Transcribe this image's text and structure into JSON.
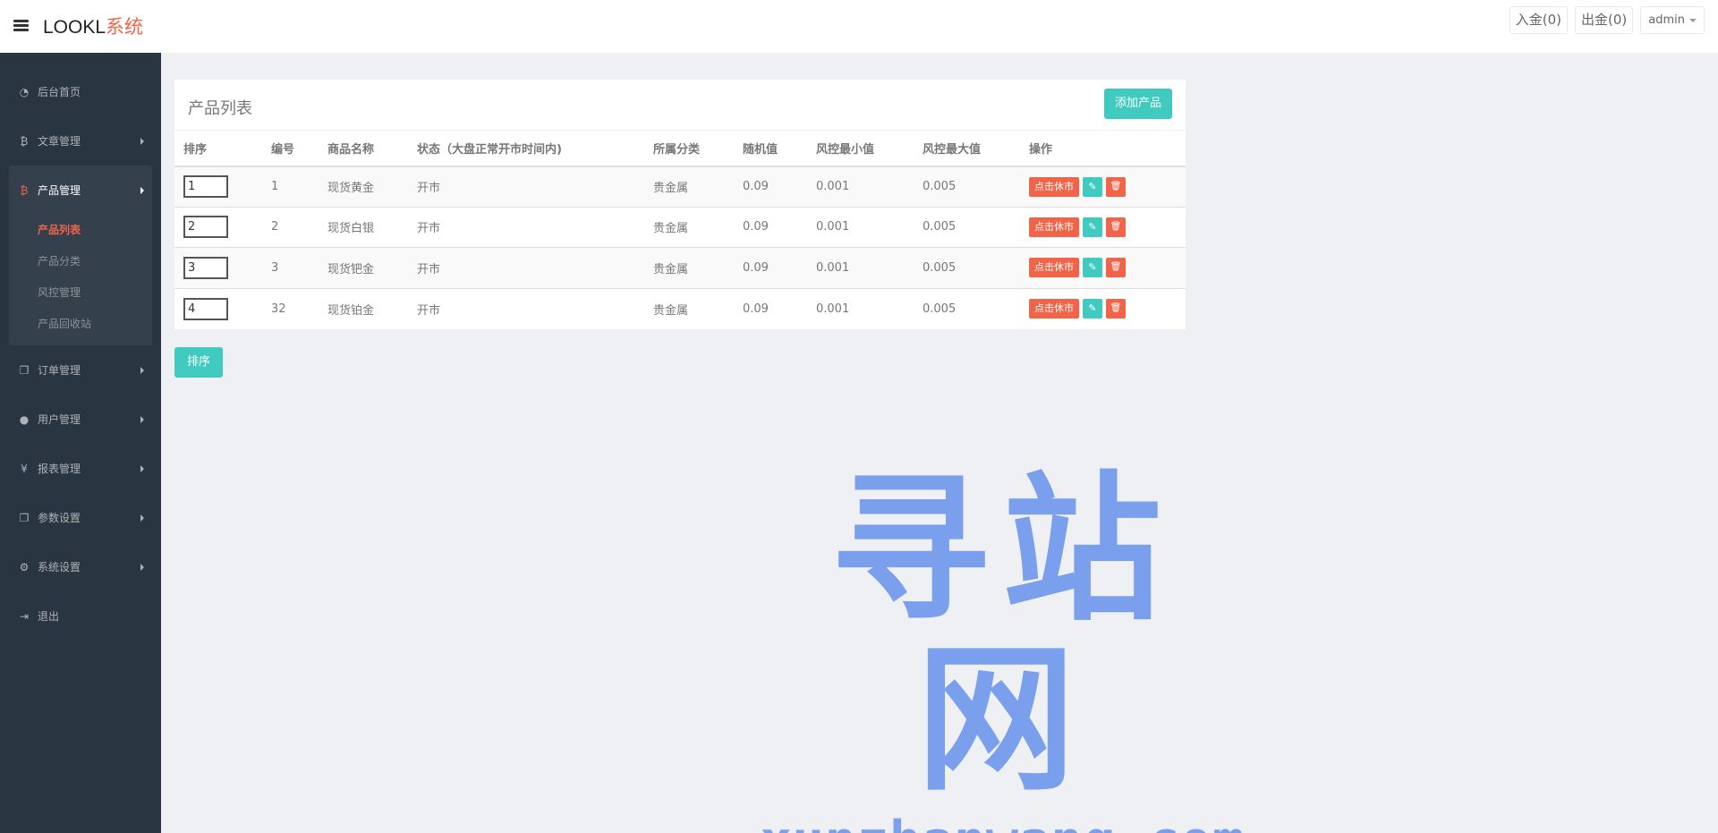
{
  "brand": {
    "main": "LOOKL",
    "accent": "系统"
  },
  "topbar": {
    "deposit": "入金(0)",
    "withdraw": "出金(0)",
    "user": "admin"
  },
  "sidebar": {
    "items": [
      {
        "label": "后台首页",
        "icon": "dashboard-icon"
      },
      {
        "label": "文章管理",
        "icon": "bitcoin-icon"
      },
      {
        "label": "产品管理",
        "icon": "bitcoin-icon"
      },
      {
        "label": "订单管理",
        "icon": "copy-icon"
      },
      {
        "label": "用户管理",
        "icon": "user-icon"
      },
      {
        "label": "报表管理",
        "icon": "yen-icon"
      },
      {
        "label": "参数设置",
        "icon": "copy-icon"
      },
      {
        "label": "系统设置",
        "icon": "gears-icon"
      },
      {
        "label": "退出",
        "icon": "sign-out-icon"
      }
    ],
    "sub_items": [
      "产品列表",
      "产品分类",
      "风控管理",
      "产品回收站"
    ]
  },
  "panel": {
    "title": "产品列表",
    "add_label": "添加产品"
  },
  "table": {
    "headers": [
      "排序",
      "编号",
      "商品名称",
      "状态（大盘正常开市时间内)",
      "所属分类",
      "随机值",
      "风控最小值",
      "风控最大值",
      "操作"
    ],
    "rows": [
      {
        "sort": "1",
        "id": "1",
        "name": "现货黄金",
        "status": "开市",
        "category": "贵金属",
        "random": "0.09",
        "min": "0.001",
        "max": "0.005"
      },
      {
        "sort": "2",
        "id": "2",
        "name": "现货白银",
        "status": "开市",
        "category": "贵金属",
        "random": "0.09",
        "min": "0.001",
        "max": "0.005"
      },
      {
        "sort": "3",
        "id": "3",
        "name": "现货钯金",
        "status": "开市",
        "category": "贵金属",
        "random": "0.09",
        "min": "0.001",
        "max": "0.005"
      },
      {
        "sort": "4",
        "id": "32",
        "name": "现货铂金",
        "status": "开市",
        "category": "贵金属",
        "random": "0.09",
        "min": "0.001",
        "max": "0.005"
      }
    ],
    "toggle_label": "点击休市"
  },
  "sort_button": "排序",
  "watermark": {
    "cn": "寻站网",
    "en": "xunzhanwang.com"
  },
  "colors": {
    "accent": "#f0654a",
    "teal": "#41cac0",
    "sidebar": "#2a3542"
  }
}
